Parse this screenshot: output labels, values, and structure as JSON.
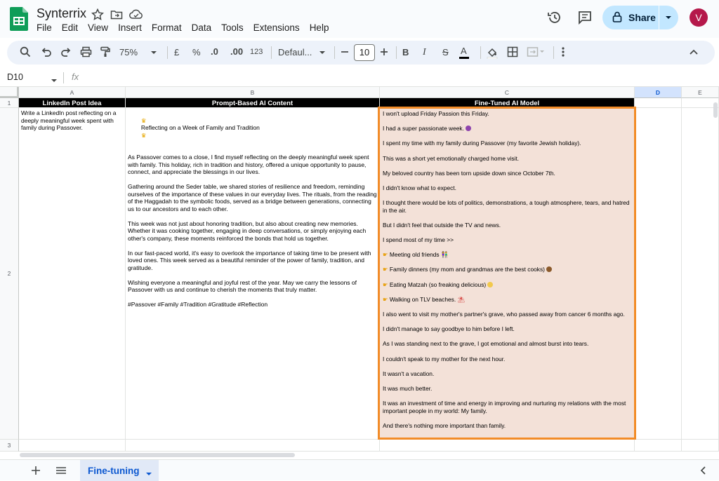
{
  "app": {
    "title": "Synterrix",
    "menus": [
      "File",
      "Edit",
      "View",
      "Insert",
      "Format",
      "Data",
      "Tools",
      "Extensions",
      "Help"
    ],
    "share_label": "Share",
    "avatar_letter": "V",
    "avatar_color": "#b5194b",
    "accent": "#c2e7ff"
  },
  "toolbar": {
    "zoom": "75%",
    "currency": "£",
    "percent": "%",
    "dec_decrease": ".0",
    "dec_increase": ".00",
    "format_123": "123",
    "font": "Defaul...",
    "font_size": "10",
    "bold": "B",
    "italic": "I",
    "strike": "S",
    "text_color_label": "A"
  },
  "formula_bar": {
    "cell_ref": "D10",
    "fx": "fx"
  },
  "grid": {
    "columns": [
      "A",
      "B",
      "C",
      "D",
      "E"
    ],
    "rows": [
      "1",
      "2",
      "3"
    ],
    "headers": [
      "LinkedIn Post Idea",
      "Prompt-Based AI Content",
      "Fine-Tuned AI Model"
    ],
    "idea": "Write a LinkedIn post reflecting on a deeply meaningful week spent with family during Passover.",
    "prompt_based": [
      "Reflecting on a Week of Family and Tradition",
      "As Passover comes to a close, I find myself reflecting on the deeply meaningful week spent with family. This holiday, rich in tradition and history, offered a unique opportunity to pause, connect, and appreciate the blessings in our lives.",
      "Gathering around the Seder table, we shared stories of resilience and freedom, reminding ourselves of the importance of these values in our everyday lives. The rituals, from the reading of the Haggadah to the symbolic foods, served as a bridge between generations, connecting us to our ancestors and to each other.",
      "This week was not just about honoring tradition, but also about creating new memories. Whether it was cooking together, engaging in deep conversations, or simply enjoying each other's company, these moments reinforced the bonds that hold us together.",
      "In our fast-paced world, it's easy to overlook the importance of taking time to be present with loved ones. This week served as a beautiful reminder of the power of family, tradition, and gratitude.",
      "Wishing everyone a meaningful and joyful rest of the year. May we carry the lessons of Passover with us and continue to cherish the moments that truly matter.",
      "#Passover #Family #Tradition #Gratitude #Reflection"
    ],
    "fine_tuned": [
      "I won't upload Friday Passion this Friday.",
      "I had a super passionate week.",
      "I spent my time with my family during Passover (my favorite Jewish holiday).",
      "This was a short yet emotionally charged home visit.",
      "My beloved country has been torn upside down since October 7th.",
      "I didn't know what to expect.",
      "I thought there would be lots of politics, demonstrations, a tough atmosphere, tears, and hatred in the air.",
      "But I didn't feel that outside the TV and news.",
      "I spend most of my time >>",
      "Meeting old friends",
      "Family dinners (my mom and grandmas are the best cooks)",
      "Eating Matzah (so freaking delicious)",
      "Walking on TLV beaches.",
      "I also went to visit my mother's partner's grave, who passed away from cancer 6 months ago.",
      "I didn't manage to say goodbye to him before I left.",
      "As I was standing next to the grave, I got emotional and almost burst into tears.",
      "I couldn't speak to my mother for the next hour.",
      "It wasn't a vacation.",
      "It was much better.",
      "It was an investment of time and energy in improving and nurturing my relations with the most important people in my world: My family.",
      "And there's nothing more important than family."
    ],
    "highlight_color": "#f28c28",
    "fine_tuned_bg": "#f3e1d8"
  },
  "sheets": {
    "active": "Fine-tuning"
  }
}
